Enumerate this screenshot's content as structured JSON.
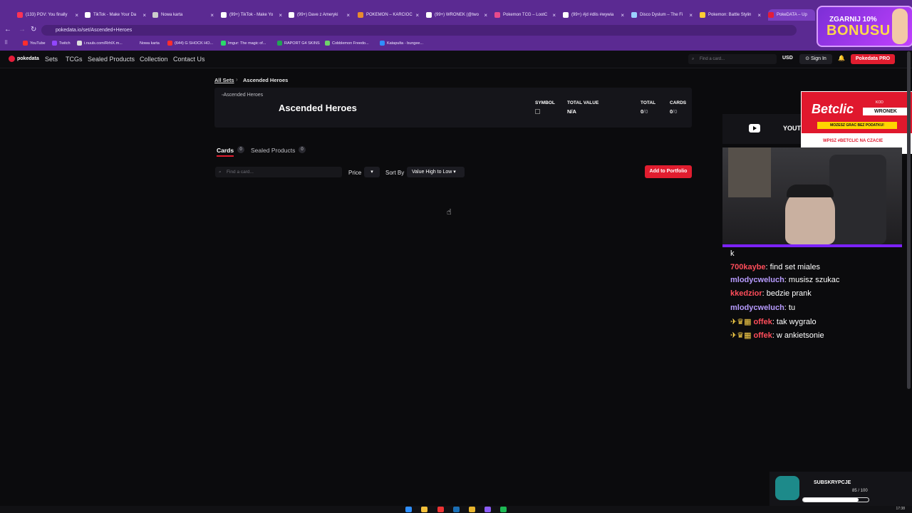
{
  "browser": {
    "tabs": [
      {
        "label": "(133) POV: You finally",
        "color": "#ff3355"
      },
      {
        "label": "TikTok - Make Your Da",
        "color": "#ffffff"
      },
      {
        "label": "Nowa karta",
        "color": "#cccccc"
      },
      {
        "label": "(99+) TikTok - Make Yo",
        "color": "#ffffff"
      },
      {
        "label": "(99+) Dave z Ameryki",
        "color": "#ffffff"
      },
      {
        "label": "POKEMON – KARCIOC",
        "color": "#e88b2e"
      },
      {
        "label": "(99+) WRONEK (@two",
        "color": "#ffffff"
      },
      {
        "label": "Pokemon TCG – LootC",
        "color": "#e84a8c"
      },
      {
        "label": "(99+) #jd #dlis #wywia",
        "color": "#ffffff"
      },
      {
        "label": "Disco Dyslum – The Fi",
        "color": "#9bd0ff"
      },
      {
        "label": "Pokemon: Battle Stylin",
        "color": "#ffcc33"
      },
      {
        "label": "PokeDATA – Up",
        "color": "#e41d3a"
      }
    ],
    "url": "pokedata.io/set/Ascended+Heroes",
    "bookmarks": [
      {
        "label": "YouTube",
        "color": "#ff2d2d"
      },
      {
        "label": "Twitch",
        "color": "#9146ff"
      },
      {
        "label": "i.nuuls.com/RrhlX.m...",
        "color": "#dddddd"
      },
      {
        "label": "Nowa karta",
        "color": "#5b2a92"
      },
      {
        "label": "(644) G SHOCK HO...",
        "color": "#ff2d2d"
      },
      {
        "label": "Imgur: The magic of...",
        "color": "#2bd96b"
      },
      {
        "label": "RAPORT G4 SKINS",
        "color": "#23a455"
      },
      {
        "label": "Cobblemon Freedo...",
        "color": "#6fd36a"
      },
      {
        "label": "Katapulta - bungee...",
        "color": "#2f8fff"
      }
    ],
    "promo": {
      "line1": "ZGARNIJ 10%",
      "line2": "BONUSU"
    }
  },
  "site": {
    "logo": "pokedata",
    "nav": [
      "Sets",
      "TCGs",
      "Sealed Products",
      "Collection",
      "Contact Us"
    ],
    "search_placeholder": "Find a card...",
    "currency": "USD",
    "sign_in": "Sign In",
    "pro_button": "Pokedata PRO"
  },
  "main": {
    "breadcrumb": {
      "all": "All Sets",
      "current": "Ascended Heroes"
    },
    "set": {
      "image_alt": "Ascended Heroes",
      "title": "Ascended Heroes",
      "symbol_label": "SYMBOL",
      "total_value_label": "TOTAL VALUE",
      "total_value": "N/A",
      "total_label": "TOTAL",
      "total_count": "0",
      "total_of": "/0",
      "cards_label": "CARDS",
      "cards_count": "0",
      "cards_of": "/0"
    },
    "tabs": {
      "cards": "Cards",
      "cards_count": "0",
      "sealed": "Sealed Products",
      "sealed_count": "0"
    },
    "filters": {
      "search_placeholder": "Find a card...",
      "price_label": "Price",
      "sort_label": "Sort By",
      "sort_value": "Value High to Low",
      "add_button": "Add to Portfolio"
    }
  },
  "overlay": {
    "betclic": {
      "brand": "Betclic",
      "code_label": "KOD",
      "code": "WRONEK",
      "promo": "MOZESZ GRAC BEZ PODATKU!",
      "wpisz": "WPISZ #BETCLIC NA CZACIE"
    },
    "youtube_text": "YOUT",
    "chat": [
      {
        "user": "k",
        "text": "",
        "user_color": "u0"
      },
      {
        "user": "700kaybe",
        "text": ": find set miales",
        "user_color": "u1"
      },
      {
        "user": "mlodycweluch",
        "text": ": musisz szukac",
        "user_color": "u2"
      },
      {
        "user": "kkedzior",
        "text": ": bedzie prank",
        "user_color": "u1"
      },
      {
        "user": "mlodycweluch",
        "text": ": tu",
        "user_color": "u2"
      },
      {
        "user": "offek",
        "text": ": tak wygralo",
        "user_color": "u1"
      },
      {
        "user": "offek",
        "text": ": w ankietsonie",
        "user_color": "u1"
      }
    ],
    "subs": {
      "title": "SUBSKRYPCJE",
      "count": "85 / 100",
      "progress": 0.85
    }
  },
  "taskbar": {
    "time": "17:38"
  }
}
